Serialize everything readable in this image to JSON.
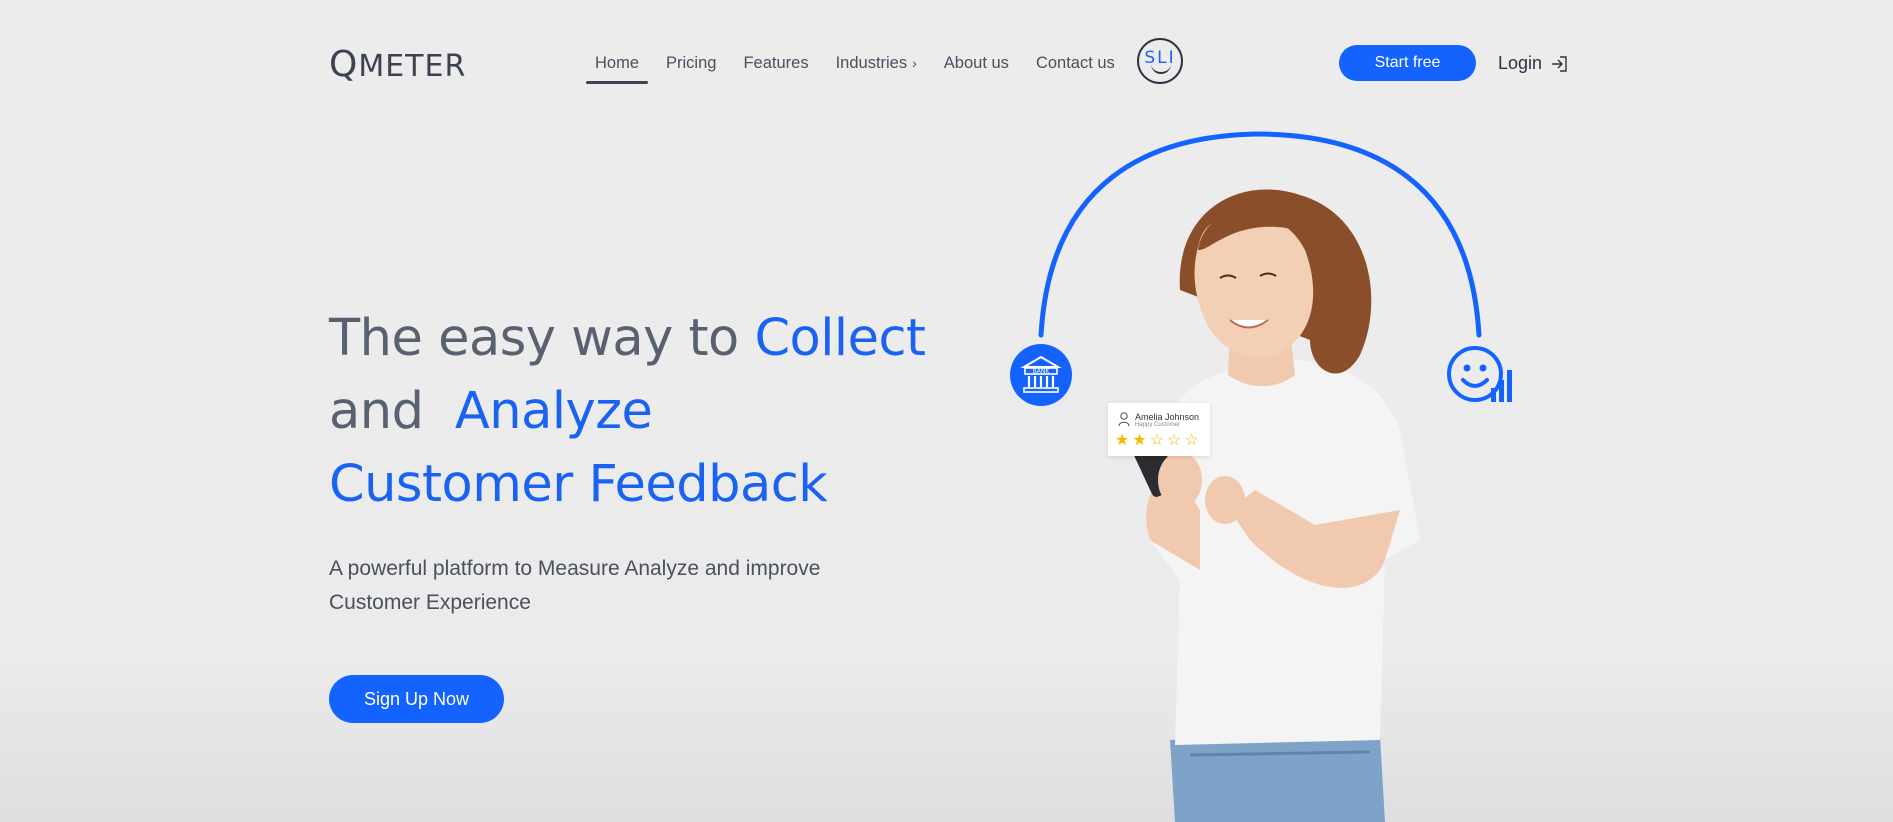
{
  "brand": {
    "logo_q": "Q",
    "logo_rest": "METER"
  },
  "nav": {
    "items": [
      {
        "label": "Home",
        "active": true
      },
      {
        "label": "Pricing"
      },
      {
        "label": "Features"
      },
      {
        "label": "Industries",
        "has_submenu": true
      },
      {
        "label": "About us"
      },
      {
        "label": "Contact us"
      }
    ],
    "chevron": "›",
    "badge_text": "SLI",
    "start_free": "Start free",
    "login": "Login"
  },
  "hero": {
    "line1_a": "The easy way to ",
    "line1_b": "Collect",
    "line2_a": "and  ",
    "line2_b": "Analyze",
    "line3": "Customer Feedback",
    "subline": "A powerful platform to Measure Analyze and improve Customer Experience",
    "cta": "Sign Up Now"
  },
  "review_card": {
    "name": "Amelia Johnson",
    "subtitle": "Happy Customer",
    "rating": 2,
    "max": 5,
    "star_on": "★",
    "star_off": "☆"
  },
  "bank_label": "BANK",
  "colors": {
    "accent": "#1463ff",
    "heading_gray": "#596170",
    "background": "#ececed"
  },
  "icons": [
    "bank-icon",
    "smile-chart-icon",
    "login-arrow-icon",
    "user-icon",
    "star-icon"
  ]
}
